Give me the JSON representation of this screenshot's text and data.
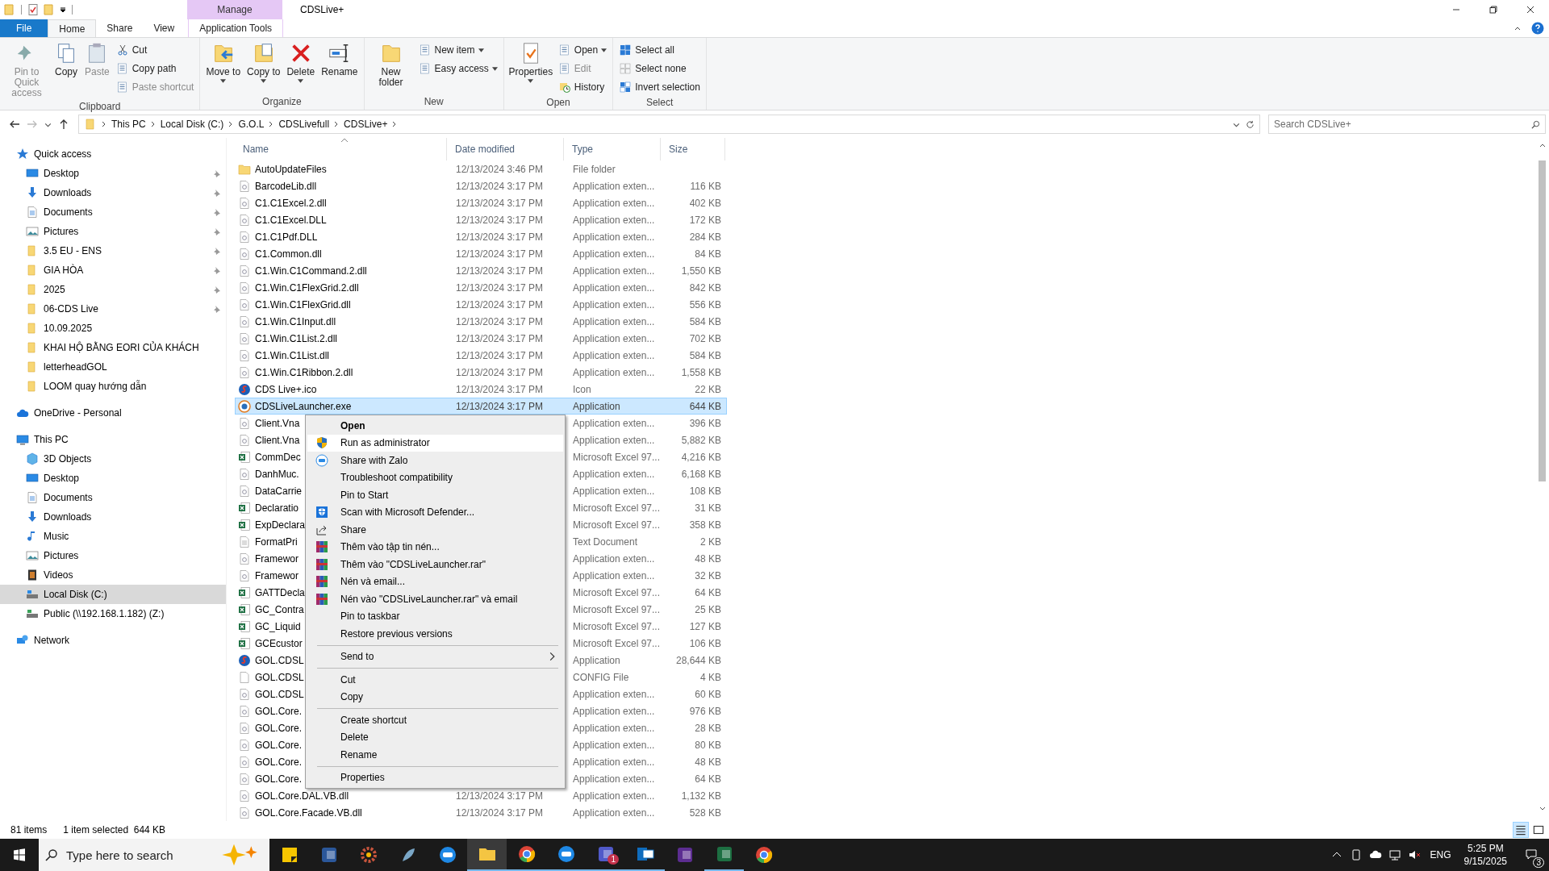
{
  "window": {
    "title": "CDSLive+",
    "context_label": "Manage"
  },
  "tabs": [
    {
      "label": "File",
      "kind": "file",
      "selected": false
    },
    {
      "label": "Home",
      "kind": "tab",
      "selected": true
    },
    {
      "label": "Share",
      "kind": "tab",
      "selected": false
    },
    {
      "label": "View",
      "kind": "tab",
      "selected": false
    },
    {
      "label": "Application Tools",
      "kind": "context",
      "selected": false
    }
  ],
  "ribbon": [
    {
      "label": "Clipboard",
      "large": [
        {
          "label": "Pin to Quick access",
          "kind": "pin",
          "disabled": true,
          "dropdown": false
        },
        {
          "label": "Copy",
          "kind": "copy",
          "disabled": false,
          "dropdown": false
        },
        {
          "label": "Paste",
          "kind": "paste",
          "disabled": true,
          "dropdown": false
        }
      ],
      "small": [
        {
          "label": "Cut",
          "kind": "cut",
          "disabled": false,
          "dropdown": false
        },
        {
          "label": "Copy path",
          "kind": "copypath",
          "disabled": false,
          "dropdown": false
        },
        {
          "label": "Paste shortcut",
          "kind": "pasteshortcut",
          "disabled": true,
          "dropdown": false
        }
      ]
    },
    {
      "label": "Organize",
      "large": [
        {
          "label": "Move to",
          "kind": "move",
          "disabled": false,
          "dropdown": true
        },
        {
          "label": "Copy to",
          "kind": "copyto",
          "disabled": false,
          "dropdown": true
        },
        {
          "label": "Delete",
          "kind": "delete",
          "disabled": false,
          "dropdown": true
        },
        {
          "label": "Rename",
          "kind": "rename",
          "disabled": false,
          "dropdown": false
        }
      ]
    },
    {
      "label": "New",
      "large": [
        {
          "label": "New folder",
          "kind": "newfolder",
          "disabled": false,
          "dropdown": false
        }
      ],
      "small": [
        {
          "label": "New item",
          "kind": "newitem",
          "disabled": false,
          "dropdown": true
        },
        {
          "label": "Easy access",
          "kind": "easyaccess",
          "disabled": false,
          "dropdown": true
        }
      ]
    },
    {
      "label": "Open",
      "large": [
        {
          "label": "Properties",
          "kind": "properties",
          "disabled": false,
          "dropdown": true
        }
      ],
      "small": [
        {
          "label": "Open",
          "kind": "open",
          "disabled": false,
          "dropdown": true
        },
        {
          "label": "Edit",
          "kind": "edit",
          "disabled": true,
          "dropdown": false
        },
        {
          "label": "History",
          "kind": "history",
          "disabled": false,
          "dropdown": false
        }
      ]
    },
    {
      "label": "Select",
      "small": [
        {
          "label": "Select all",
          "kind": "selectall",
          "disabled": false,
          "dropdown": false
        },
        {
          "label": "Select none",
          "kind": "selectnone",
          "disabled": false,
          "dropdown": false
        },
        {
          "label": "Invert selection",
          "kind": "invert",
          "disabled": false,
          "dropdown": false
        }
      ]
    }
  ],
  "address": {
    "breadcrumbs": [
      "This PC",
      "Local Disk (C:)",
      "G.O.L",
      "CDSLivefull",
      "CDSLive+"
    ],
    "search_placeholder": "Search CDSLive+"
  },
  "navigation": [
    {
      "label": "Quick access",
      "kind": "star",
      "selected": false,
      "children": [
        {
          "label": "Desktop",
          "kind": "desktop",
          "pinned": true,
          "selected": false
        },
        {
          "label": "Downloads",
          "kind": "downloads",
          "pinned": true,
          "selected": false
        },
        {
          "label": "Documents",
          "kind": "documents",
          "pinned": true,
          "selected": false
        },
        {
          "label": "Pictures",
          "kind": "pictures",
          "pinned": true,
          "selected": false
        },
        {
          "label": "3.5 EU - ENS",
          "kind": "folder",
          "pinned": true,
          "selected": false
        },
        {
          "label": "GIA HÒA",
          "kind": "folder",
          "pinned": true,
          "selected": false
        },
        {
          "label": "2025",
          "kind": "folder",
          "pinned": true,
          "selected": false
        },
        {
          "label": "06-CDS Live",
          "kind": "folder",
          "pinned": true,
          "selected": false
        },
        {
          "label": "10.09.2025",
          "kind": "folder",
          "pinned": false,
          "selected": false
        },
        {
          "label": "KHAI HỘ BẰNG EORI CỦA KHÁCH",
          "kind": "folder",
          "pinned": false,
          "selected": false
        },
        {
          "label": "letterheadGOL",
          "kind": "folder",
          "pinned": false,
          "selected": false
        },
        {
          "label": "LOOM quay hướng dẫn",
          "kind": "folder",
          "pinned": false,
          "selected": false
        }
      ]
    },
    {
      "label": "OneDrive - Personal",
      "kind": "cloud",
      "selected": false
    },
    {
      "label": "This PC",
      "kind": "pc",
      "selected": false,
      "children": [
        {
          "label": "3D Objects",
          "kind": "cube",
          "selected": false
        },
        {
          "label": "Desktop",
          "kind": "desktop",
          "selected": false
        },
        {
          "label": "Documents",
          "kind": "documents",
          "selected": false
        },
        {
          "label": "Downloads",
          "kind": "downloads",
          "selected": false
        },
        {
          "label": "Music",
          "kind": "music",
          "selected": false
        },
        {
          "label": "Pictures",
          "kind": "pictures",
          "selected": false
        },
        {
          "label": "Videos",
          "kind": "videos",
          "selected": false
        },
        {
          "label": "Local Disk (C:)",
          "kind": "disk",
          "selected": true
        },
        {
          "label": "Public (\\\\192.168.1.182) (Z:)",
          "kind": "netdrive",
          "selected": false
        }
      ]
    },
    {
      "label": "Network",
      "kind": "network",
      "selected": false
    }
  ],
  "table": {
    "columns": [
      {
        "label": "Name",
        "sorted": true
      },
      {
        "label": "Date modified",
        "sorted": false
      },
      {
        "label": "Type",
        "sorted": false
      },
      {
        "label": "Size",
        "sorted": false
      }
    ],
    "rows": [
      {
        "kind": "folder",
        "name": "AutoUpdateFiles",
        "date": "12/13/2024 3:46 PM",
        "type": "File folder",
        "selected": false
      },
      {
        "kind": "dll",
        "name": "BarcodeLib.dll",
        "date": "12/13/2024 3:17 PM",
        "type": "Application exten...",
        "size": "116 KB",
        "selected": false
      },
      {
        "kind": "dll",
        "name": "C1.C1Excel.2.dll",
        "date": "12/13/2024 3:17 PM",
        "type": "Application exten...",
        "size": "402 KB",
        "selected": false
      },
      {
        "kind": "dll",
        "name": "C1.C1Excel.DLL",
        "date": "12/13/2024 3:17 PM",
        "type": "Application exten...",
        "size": "172 KB",
        "selected": false
      },
      {
        "kind": "dll",
        "name": "C1.C1Pdf.DLL",
        "date": "12/13/2024 3:17 PM",
        "type": "Application exten...",
        "size": "284 KB",
        "selected": false
      },
      {
        "kind": "dll",
        "name": "C1.Common.dll",
        "date": "12/13/2024 3:17 PM",
        "type": "Application exten...",
        "size": "84 KB",
        "selected": false
      },
      {
        "kind": "dll",
        "name": "C1.Win.C1Command.2.dll",
        "date": "12/13/2024 3:17 PM",
        "type": "Application exten...",
        "size": "1,550 KB",
        "selected": false
      },
      {
        "kind": "dll",
        "name": "C1.Win.C1FlexGrid.2.dll",
        "date": "12/13/2024 3:17 PM",
        "type": "Application exten...",
        "size": "842 KB",
        "selected": false
      },
      {
        "kind": "dll",
        "name": "C1.Win.C1FlexGrid.dll",
        "date": "12/13/2024 3:17 PM",
        "type": "Application exten...",
        "size": "556 KB",
        "selected": false
      },
      {
        "kind": "dll",
        "name": "C1.Win.C1Input.dll",
        "date": "12/13/2024 3:17 PM",
        "type": "Application exten...",
        "size": "584 KB",
        "selected": false
      },
      {
        "kind": "dll",
        "name": "C1.Win.C1List.2.dll",
        "date": "12/13/2024 3:17 PM",
        "type": "Application exten...",
        "size": "702 KB",
        "selected": false
      },
      {
        "kind": "dll",
        "name": "C1.Win.C1List.dll",
        "date": "12/13/2024 3:17 PM",
        "type": "Application exten...",
        "size": "584 KB",
        "selected": false
      },
      {
        "kind": "dll",
        "name": "C1.Win.C1Ribbon.2.dll",
        "date": "12/13/2024 3:17 PM",
        "type": "Application exten...",
        "size": "1,558 KB",
        "selected": false
      },
      {
        "kind": "logo",
        "name": "CDS Live+.ico",
        "date": "12/13/2024 3:17 PM",
        "type": "Icon",
        "size": "22 KB",
        "selected": false
      },
      {
        "kind": "launcher",
        "name": "CDSLiveLauncher.exe",
        "date": "12/13/2024 3:17 PM",
        "type": "Application",
        "size": "644 KB",
        "selected": true
      },
      {
        "kind": "dll",
        "name": "Client.Vna",
        "type": "Application exten...",
        "size": "396 KB",
        "selected": false
      },
      {
        "kind": "dll",
        "name": "Client.Vna",
        "type": "Application exten...",
        "size": "5,882 KB",
        "selected": false
      },
      {
        "kind": "excel",
        "name": "CommDec",
        "type": "Microsoft Excel 97...",
        "size": "4,216 KB",
        "selected": false
      },
      {
        "kind": "dll",
        "name": "DanhMuc.",
        "type": "Application exten...",
        "size": "6,168 KB",
        "selected": false
      },
      {
        "kind": "dll",
        "name": "DataCarrie",
        "type": "Application exten...",
        "size": "108 KB",
        "selected": false
      },
      {
        "kind": "excel",
        "name": "Declaratio",
        "type": "Microsoft Excel 97...",
        "size": "31 KB",
        "selected": false
      },
      {
        "kind": "excel",
        "name": "ExpDeclara",
        "type": "Microsoft Excel 97...",
        "size": "358 KB",
        "selected": false
      },
      {
        "kind": "text",
        "name": "FormatPri",
        "type": "Text Document",
        "size": "2 KB",
        "selected": false
      },
      {
        "kind": "dll",
        "name": "Framewor",
        "type": "Application exten...",
        "size": "48 KB",
        "selected": false
      },
      {
        "kind": "dll",
        "name": "Framewor",
        "type": "Application exten...",
        "size": "32 KB",
        "selected": false
      },
      {
        "kind": "excel",
        "name": "GATTDecla",
        "type": "Microsoft Excel 97...",
        "size": "64 KB",
        "selected": false
      },
      {
        "kind": "excel",
        "name": "GC_Contra",
        "type": "Microsoft Excel 97...",
        "size": "25 KB",
        "selected": false
      },
      {
        "kind": "excel",
        "name": "GC_Liquid",
        "type": "Microsoft Excel 97...",
        "size": "127 KB",
        "selected": false
      },
      {
        "kind": "excel",
        "name": "GCEcustor",
        "type": "Microsoft Excel 97...",
        "size": "106 KB",
        "selected": false
      },
      {
        "kind": "logo",
        "name": "GOL.CDSL",
        "type": "Application",
        "size": "28,644 KB",
        "selected": false
      },
      {
        "kind": "blank",
        "name": "GOL.CDSL",
        "type": "CONFIG File",
        "size": "4 KB",
        "selected": false
      },
      {
        "kind": "dll",
        "name": "GOL.CDSL",
        "type": "Application exten...",
        "size": "60 KB",
        "selected": false
      },
      {
        "kind": "dll",
        "name": "GOL.Core.",
        "type": "Application exten...",
        "size": "976 KB",
        "selected": false
      },
      {
        "kind": "dll",
        "name": "GOL.Core.",
        "type": "Application exten...",
        "size": "28 KB",
        "selected": false
      },
      {
        "kind": "dll",
        "name": "GOL.Core.",
        "type": "Application exten...",
        "size": "80 KB",
        "selected": false
      },
      {
        "kind": "dll",
        "name": "GOL.Core.",
        "type": "Application exten...",
        "size": "48 KB",
        "selected": false
      },
      {
        "kind": "dll",
        "name": "GOL.Core.",
        "type": "Application exten...",
        "size": "64 KB",
        "selected": false
      },
      {
        "kind": "dll",
        "name": "GOL.Core.DAL.VB.dll",
        "date": "12/13/2024 3:17 PM",
        "type": "Application exten...",
        "size": "1,132 KB",
        "selected": false
      },
      {
        "kind": "dll",
        "name": "GOL.Core.Facade.VB.dll",
        "date": "12/13/2024 3:17 PM",
        "type": "Application exten...",
        "size": "528 KB",
        "selected": false
      }
    ]
  },
  "context_menu": {
    "items": [
      {
        "kind": "plain",
        "label": "Open",
        "default": true,
        "selected": false
      },
      {
        "kind": "shield",
        "label": "Run as administrator",
        "default": false,
        "selected": true
      },
      {
        "kind": "chat",
        "label": "Share with Zalo",
        "default": false,
        "selected": false
      },
      {
        "kind": "plain",
        "label": "Troubleshoot compatibility",
        "default": false,
        "selected": false
      },
      {
        "kind": "plain",
        "label": "Pin to Start",
        "default": false,
        "selected": false
      },
      {
        "kind": "defender",
        "label": "Scan with Microsoft Defender...",
        "default": false,
        "selected": false
      },
      {
        "kind": "share",
        "label": "Share",
        "default": false,
        "selected": false
      },
      {
        "kind": "archive",
        "label": "Thêm vào tập tin nén...",
        "default": false,
        "selected": false
      },
      {
        "kind": "archive",
        "label": "Thêm vào \"CDSLiveLauncher.rar\"",
        "default": false,
        "selected": false
      },
      {
        "kind": "archive",
        "label": "Nén và email...",
        "default": false,
        "selected": false
      },
      {
        "kind": "archive",
        "label": "Nén vào \"CDSLiveLauncher.rar\" và email",
        "default": false,
        "selected": false
      },
      {
        "kind": "plain",
        "label": "Pin to taskbar",
        "default": false,
        "selected": false
      },
      {
        "kind": "plain",
        "label": "Restore previous versions",
        "default": false,
        "selected": false
      },
      {
        "kind": "separator"
      },
      {
        "kind": "submenu",
        "label": "Send to",
        "default": false,
        "selected": false
      },
      {
        "kind": "separator"
      },
      {
        "kind": "plain",
        "label": "Cut",
        "default": false,
        "selected": false
      },
      {
        "kind": "plain",
        "label": "Copy",
        "default": false,
        "selected": false
      },
      {
        "kind": "separator"
      },
      {
        "kind": "plain",
        "label": "Create shortcut",
        "default": false,
        "selected": false
      },
      {
        "kind": "plain",
        "label": "Delete",
        "default": false,
        "selected": false
      },
      {
        "kind": "plain",
        "label": "Rename",
        "default": false,
        "selected": false
      },
      {
        "kind": "separator"
      },
      {
        "kind": "plain",
        "label": "Properties",
        "default": false,
        "selected": false
      }
    ]
  },
  "status_bar": {
    "item_count": "81 items",
    "selection": "1 item selected  644 KB"
  },
  "taskbar": {
    "search_placeholder": "Type here to search",
    "apps": [
      {
        "kind": "note",
        "running": false
      },
      {
        "kind": "doc",
        "running": false
      },
      {
        "kind": "gear",
        "running": false
      },
      {
        "kind": "feather",
        "running": false
      },
      {
        "kind": "chat",
        "running": false
      },
      {
        "kind": "folder",
        "running": true,
        "selected": true
      },
      {
        "kind": "browser",
        "running": true
      },
      {
        "kind": "chat",
        "running": true
      },
      {
        "kind": "team",
        "running": true,
        "badge": "1"
      },
      {
        "kind": "mail",
        "running": true
      },
      {
        "kind": "purple",
        "running": false
      },
      {
        "kind": "sheet",
        "running": true
      },
      {
        "kind": "browser",
        "running": false
      }
    ],
    "language": "ENG",
    "time": "5:25 PM",
    "date": "9/15/2025",
    "notification_count": "3"
  }
}
